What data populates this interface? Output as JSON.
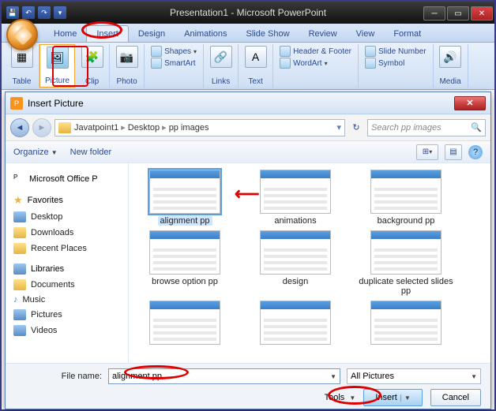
{
  "app_title": "Presentation1 - Microsoft PowerPoint",
  "tabs": {
    "home": "Home",
    "insert": "Insert",
    "design": "Design",
    "animations": "Animations",
    "slideshow": "Slide Show",
    "review": "Review",
    "view": "View",
    "format": "Format"
  },
  "ribbon": {
    "table": "Table",
    "picture": "Picture",
    "clip": "Clip",
    "photo": "Photo",
    "shapes": "Shapes",
    "smartart": "SmartArt",
    "links": "Links",
    "text": "Text",
    "header": "Header & Footer",
    "wordart": "WordArt",
    "slidenum": "Slide Number",
    "symbol": "Symbol",
    "media": "Media"
  },
  "dialog": {
    "title": "Insert Picture",
    "crumbs": [
      "Javatpoint1",
      "Desktop",
      "pp images"
    ],
    "search_placeholder": "Search pp images",
    "organize": "Organize",
    "newfolder": "New folder",
    "sidebar": {
      "office": "Microsoft Office P",
      "favorites": "Favorites",
      "desktop": "Desktop",
      "downloads": "Downloads",
      "recent": "Recent Places",
      "libraries": "Libraries",
      "documents": "Documents",
      "music": "Music",
      "pictures": "Pictures",
      "videos": "Videos"
    },
    "files": [
      "alignment pp",
      "animations",
      "background pp",
      "browse option pp",
      "design",
      "duplicate selected slides pp"
    ],
    "filename_label": "File name:",
    "filename_value": "alignment pp",
    "filter": "All Pictures",
    "tools": "Tools",
    "insert": "Insert",
    "cancel": "Cancel"
  }
}
